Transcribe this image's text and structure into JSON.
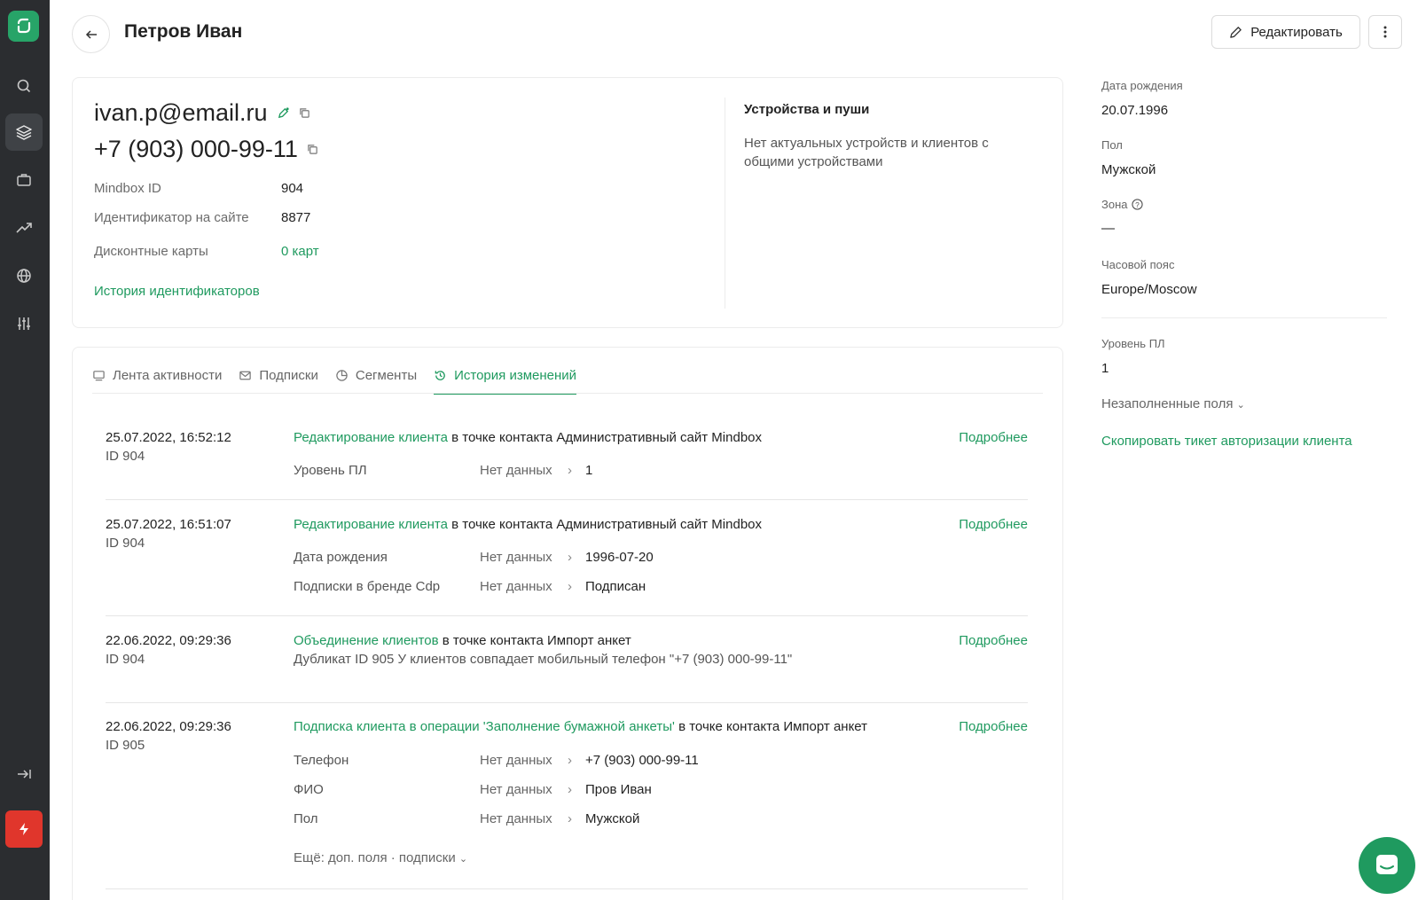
{
  "header": {
    "title": "Петров Иван",
    "edit_label": "Редактировать"
  },
  "profile": {
    "email": "ivan.p@email.ru",
    "phone": "+7 (903) 000-99-11",
    "fields": [
      {
        "label": "Mindbox ID",
        "value": "904"
      },
      {
        "label": "Идентификатор на сайте",
        "value": "8877"
      },
      {
        "label": "Дисконтные карты",
        "value": "0 карт"
      }
    ],
    "id_history_link": "История идентификаторов"
  },
  "devices": {
    "title": "Устройства и пуши",
    "text": "Нет актуальных устройств и клиентов с общими устройствами"
  },
  "tabs": [
    {
      "label": "Лента активности",
      "icon": "feed-icon",
      "active": false
    },
    {
      "label": "Подписки",
      "icon": "mail-icon",
      "active": false
    },
    {
      "label": "Сегменты",
      "icon": "pie-chart-icon",
      "active": false
    },
    {
      "label": "История изменений",
      "icon": "history-icon",
      "active": true
    }
  ],
  "history": {
    "more_label": "Подробнее",
    "entries": [
      {
        "date": "25.07.2022, 16:52:12",
        "id": "ID 904",
        "action": "Редактирование клиента",
        "context": " в точке контакта Административный сайт Mindbox",
        "changes": [
          {
            "field": "Уровень ПЛ",
            "old": "Нет данных",
            "new": "1"
          }
        ]
      },
      {
        "date": "25.07.2022, 16:51:07",
        "id": "ID 904",
        "action": "Редактирование клиента",
        "context": " в точке контакта Административный сайт Mindbox",
        "changes": [
          {
            "field": "Дата рождения",
            "old": "Нет данных",
            "new": "1996-07-20"
          },
          {
            "field": "Подписки в бренде Cdp",
            "old": "Нет данных",
            "new": "Подписан"
          }
        ]
      },
      {
        "date": "22.06.2022, 09:29:36",
        "id": "ID 904",
        "action": "Объединение клиентов",
        "context": " в точке контакта Импорт анкет",
        "description": "Дубликат ID 905 У клиентов совпадает мобильный телефон \"+7 (903) 000-99-11\""
      },
      {
        "date": "22.06.2022, 09:29:36",
        "id": "ID 905",
        "action": "Подписка клиента в операции 'Заполнение бумажной анкеты'",
        "context": " в точке контакта Импорт анкет",
        "changes": [
          {
            "field": "Телефон",
            "old": "Нет данных",
            "new": "+7 (903) 000-99-11"
          },
          {
            "field": "ФИО",
            "old": "Нет данных",
            "new": "Пров Иван"
          },
          {
            "field": "Пол",
            "old": "Нет данных",
            "new": "Мужской"
          }
        ],
        "more_fields": "Ещё: доп. поля · подписки"
      }
    ]
  },
  "right_panel": {
    "fields": [
      {
        "label": "Дата рождения",
        "value": "20.07.1996"
      },
      {
        "label": "Пол",
        "value": "Мужской"
      },
      {
        "label": "Зона",
        "value": "—"
      },
      {
        "label": "Часовой пояс",
        "value": "Europe/Moscow"
      },
      {
        "label": "Уровень ПЛ",
        "value": "1"
      }
    ],
    "empty_fields_label": "Незаполненные поля",
    "copy_ticket_link": "Скопировать тикет авторизации клиента"
  },
  "colors": {
    "accent": "#1f9a5f",
    "sidebar": "#2b2d30",
    "alert": "#e0362c"
  }
}
